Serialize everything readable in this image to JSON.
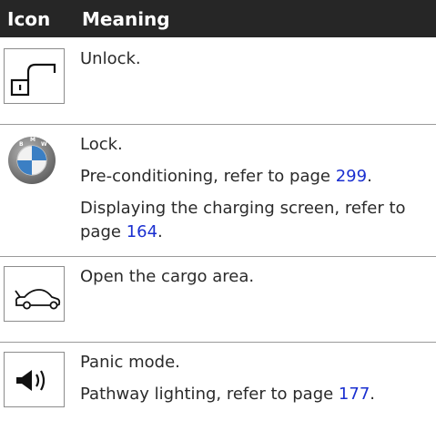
{
  "header": {
    "icon": "Icon",
    "meaning": "Meaning"
  },
  "rows": [
    {
      "icon": "unlock-icon",
      "lines": [
        {
          "text": "Unlock."
        }
      ]
    },
    {
      "icon": "bmw-logo-icon",
      "logo_letters": "BMW",
      "lines": [
        {
          "text": "Lock."
        },
        {
          "text": "Pre-conditioning, refer to page ",
          "link": "299",
          "end": "."
        },
        {
          "text": "Displaying the charging screen, refer to page ",
          "link": "164",
          "end": "."
        }
      ]
    },
    {
      "icon": "trunk-open-icon",
      "lines": [
        {
          "text": "Open the cargo area."
        }
      ]
    },
    {
      "icon": "horn-sound-icon",
      "lines": [
        {
          "text": "Panic mode."
        },
        {
          "text": "Pathway lighting, refer to page ",
          "link": "177",
          "end": "."
        }
      ]
    }
  ],
  "colors": {
    "header_bg": "#262626",
    "header_text": "#ffffff",
    "link": "#1a2fd0"
  }
}
